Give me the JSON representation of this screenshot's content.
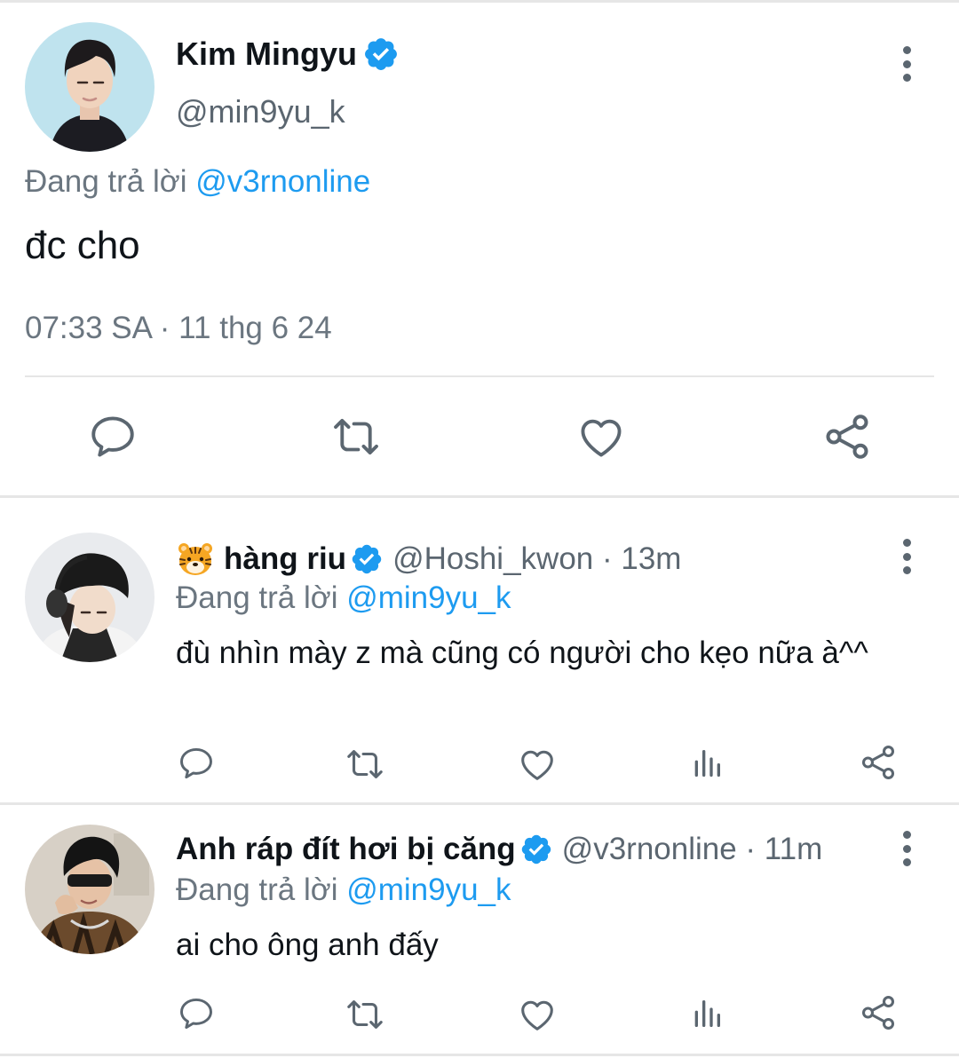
{
  "main_tweet": {
    "author_name": "Kim Mingyu",
    "handle": "@min9yu_k",
    "replying_prefix": "Đang trả lời",
    "replying_to": "@v3rnonline",
    "text": "đc cho",
    "timestamp": "07:33 SA · 11 thg 6 24"
  },
  "replies": [
    {
      "author_name": "hàng riu",
      "handle_time": "@Hoshi_kwon · 13m",
      "replying_prefix": "Đang trả lời",
      "replying_to": "@min9yu_k",
      "text": "đù nhìn mày z mà cũng có người cho kẹo nữa à^^"
    },
    {
      "author_name": "Anh ráp đít hơi bị căng",
      "handle_time": "@v3rnonline · 11m",
      "replying_prefix": "Đang trả lời",
      "replying_to": "@min9yu_k",
      "text": "ai cho ông anh đấy"
    }
  ],
  "colors": {
    "accent": "#1d9bf0",
    "secondary_text": "#6b7680",
    "icon": "#5b6670",
    "divider": "#e6e6e6"
  },
  "icons": [
    "verified-badge-icon",
    "reply-icon",
    "retweet-icon",
    "like-icon",
    "views-icon",
    "share-icon",
    "more-options-icon",
    "tiger-emoji-icon"
  ]
}
